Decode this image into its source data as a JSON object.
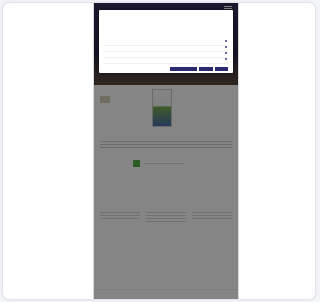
{
  "app": {
    "brand": "",
    "menu_label": ""
  },
  "modal": {
    "title": "",
    "text": "",
    "link_text": "",
    "rows": [
      {
        "name": "",
        "toggle": ""
      },
      {
        "name": "",
        "toggle": ""
      },
      {
        "name": "",
        "toggle": ""
      },
      {
        "name": "",
        "toggle": ""
      }
    ],
    "buttons": [
      "",
      "",
      ""
    ]
  },
  "hero": {
    "title": ""
  },
  "book": {
    "left_title": "",
    "right_title": "",
    "right_subtitle": ""
  },
  "about": {
    "title": "",
    "cta": ""
  },
  "order": {
    "title": "",
    "columns": [
      {
        "title": "",
        "cta": ""
      },
      {
        "title": "",
        "cta": ""
      },
      {
        "title": "",
        "cta": ""
      }
    ]
  },
  "footer": {
    "links": ""
  },
  "colors": {
    "primary": "#2c2a6e",
    "accent": "#f2a536",
    "green": "#57b34a"
  }
}
